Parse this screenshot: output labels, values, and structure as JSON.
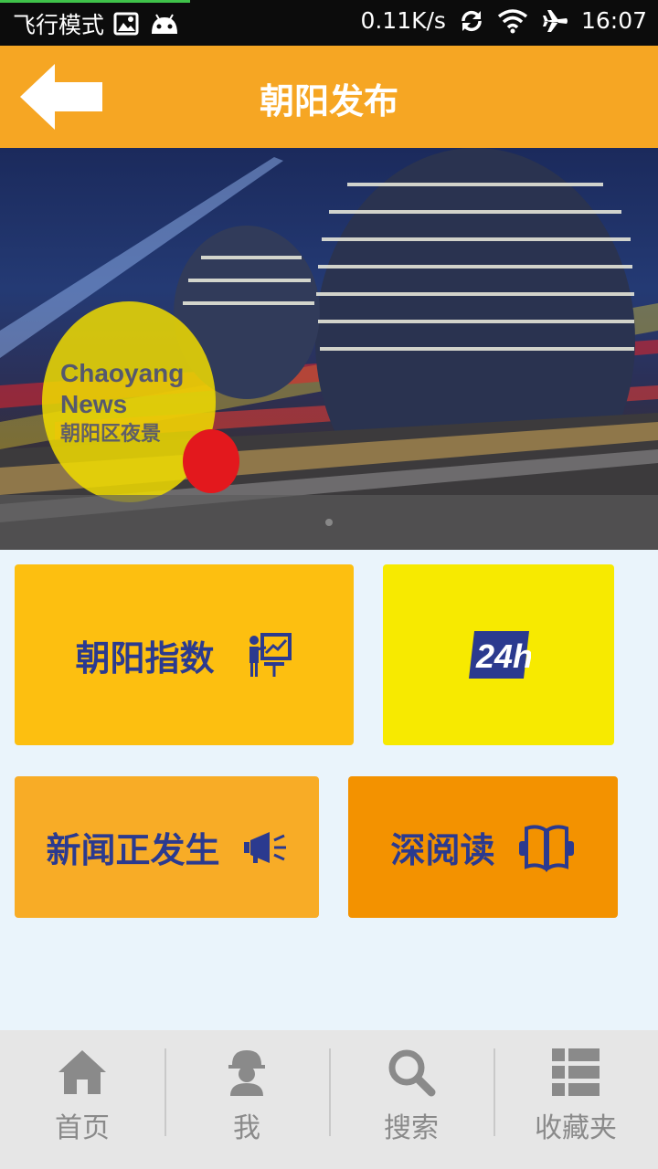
{
  "status_bar": {
    "mode": "飞行模式",
    "speed": "0.11K/s",
    "time": "16:07",
    "icons": [
      "image-icon",
      "android-icon",
      "sync-icon",
      "wifi-icon",
      "airplane-icon"
    ]
  },
  "header": {
    "title": "朝阳发布",
    "back_icon": "back-arrow-icon"
  },
  "banner": {
    "logo_en_line1": "Chaoyang",
    "logo_en_line2": "News",
    "logo_zh": "朝阳区夜景",
    "slide_count": 1,
    "active_slide": 1
  },
  "tiles": {
    "index_label": "朝阳指数",
    "badge_24h": "24h",
    "news_label": "新闻正发生",
    "deep_label": "深阅读"
  },
  "bottom_nav": {
    "items": [
      {
        "label": "首页",
        "icon": "home-icon"
      },
      {
        "label": "我",
        "icon": "profile-icon"
      },
      {
        "label": "搜索",
        "icon": "search-icon"
      },
      {
        "label": "收藏夹",
        "icon": "list-icon"
      }
    ]
  },
  "colors": {
    "header": "#f6a623",
    "tile_index": "#fdbf10",
    "tile_24h": "#f7ea00",
    "tile_news": "#f8ac26",
    "tile_deep": "#f39200",
    "tile_text": "#2b3a8f"
  }
}
